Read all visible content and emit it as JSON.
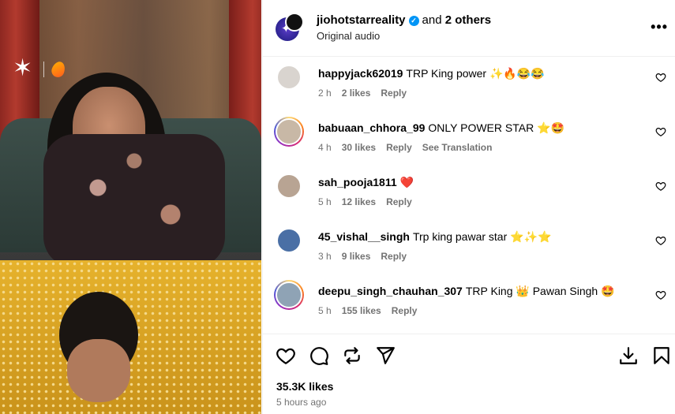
{
  "post": {
    "author": "jiohotstarreality",
    "collab_text": "and",
    "collab_count": "2 others",
    "audio": "Original audio",
    "more_label": "•••"
  },
  "media": {
    "logo_star": "✶"
  },
  "comments": [
    {
      "user": "happyjack62019",
      "text": "TRP King power ✨🔥😂😂",
      "time": "2 h",
      "likes": "2 likes",
      "reply": "Reply",
      "extra": "",
      "avatar_color": "#d9d4cf",
      "story_ring": false
    },
    {
      "user": "babuaan_chhora_99",
      "text": "ONLY POWER STAR ⭐🤩",
      "time": "4 h",
      "likes": "30 likes",
      "reply": "Reply",
      "extra": "See Translation",
      "avatar_color": "#c8b8a6",
      "story_ring": true
    },
    {
      "user": "sah_pooja1811",
      "text": "❤️",
      "time": "5 h",
      "likes": "12 likes",
      "reply": "Reply",
      "extra": "",
      "avatar_color": "#b8a493",
      "story_ring": false
    },
    {
      "user": "45_vishal__singh",
      "text": "Trp king pawar star ⭐✨⭐",
      "time": "3 h",
      "likes": "9 likes",
      "reply": "Reply",
      "extra": "",
      "avatar_color": "#4a6fa5",
      "story_ring": false
    },
    {
      "user": "deepu_singh_chauhan_307",
      "text": "TRP King 👑 Pawan Singh 🤩",
      "time": "5 h",
      "likes": "155 likes",
      "reply": "Reply",
      "extra": "",
      "avatar_color": "#8fa3b5",
      "story_ring": true
    }
  ],
  "footer": {
    "likes": "35.3K likes",
    "time": "5 hours ago"
  }
}
